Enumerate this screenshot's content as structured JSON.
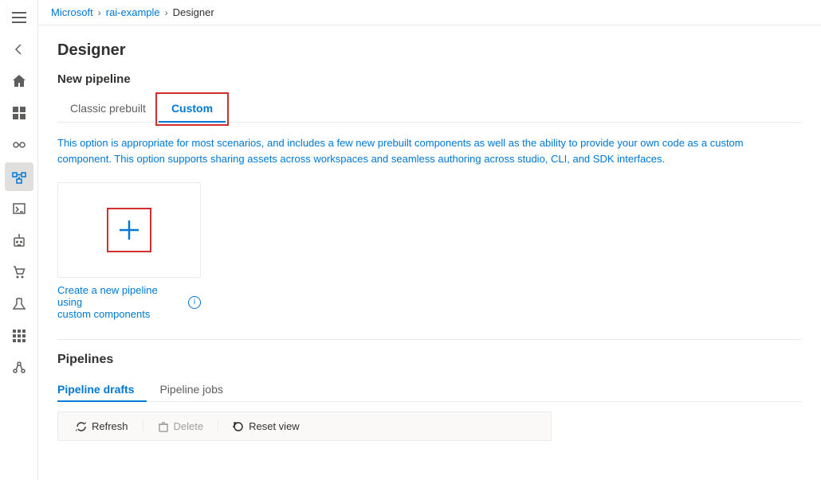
{
  "breadcrumb": {
    "items": [
      "Microsoft",
      "rai-example",
      "Designer"
    ],
    "separators": [
      ">",
      ">"
    ]
  },
  "page": {
    "title": "Designer",
    "new_pipeline_section": "New pipeline",
    "description": "This option is appropriate for most scenarios, and includes a few new prebuilt components as well as the ability to provide your own code as a custom component. This option supports sharing assets across workspaces and seamless authoring across studio, CLI, and SDK interfaces.",
    "tabs": [
      {
        "label": "Classic prebuilt",
        "active": false
      },
      {
        "label": "Custom",
        "active": true
      }
    ],
    "card_label_line1": "Create a new pipeline using",
    "card_label_line2": "custom components"
  },
  "pipelines": {
    "title": "Pipelines",
    "sub_tabs": [
      {
        "label": "Pipeline drafts",
        "active": true
      },
      {
        "label": "Pipeline jobs",
        "active": false
      }
    ],
    "toolbar": {
      "refresh": "Refresh",
      "delete": "Delete",
      "reset_view": "Reset view"
    }
  },
  "sidebar": {
    "items": [
      {
        "name": "menu-icon",
        "glyph": "☰"
      },
      {
        "name": "back-icon",
        "glyph": "←"
      },
      {
        "name": "home-icon",
        "glyph": "⌂"
      },
      {
        "name": "dashboard-icon",
        "glyph": "▦"
      },
      {
        "name": "pipeline-icon",
        "glyph": "⑂",
        "active": true
      },
      {
        "name": "terminal-icon",
        "glyph": ">_"
      },
      {
        "name": "settings-icon",
        "glyph": "⚙"
      },
      {
        "name": "cart-icon",
        "glyph": "⊞"
      },
      {
        "name": "lab-icon",
        "glyph": "⚗"
      },
      {
        "name": "grid-icon",
        "glyph": "⊞"
      },
      {
        "name": "nodes-icon",
        "glyph": "⊹"
      }
    ]
  }
}
